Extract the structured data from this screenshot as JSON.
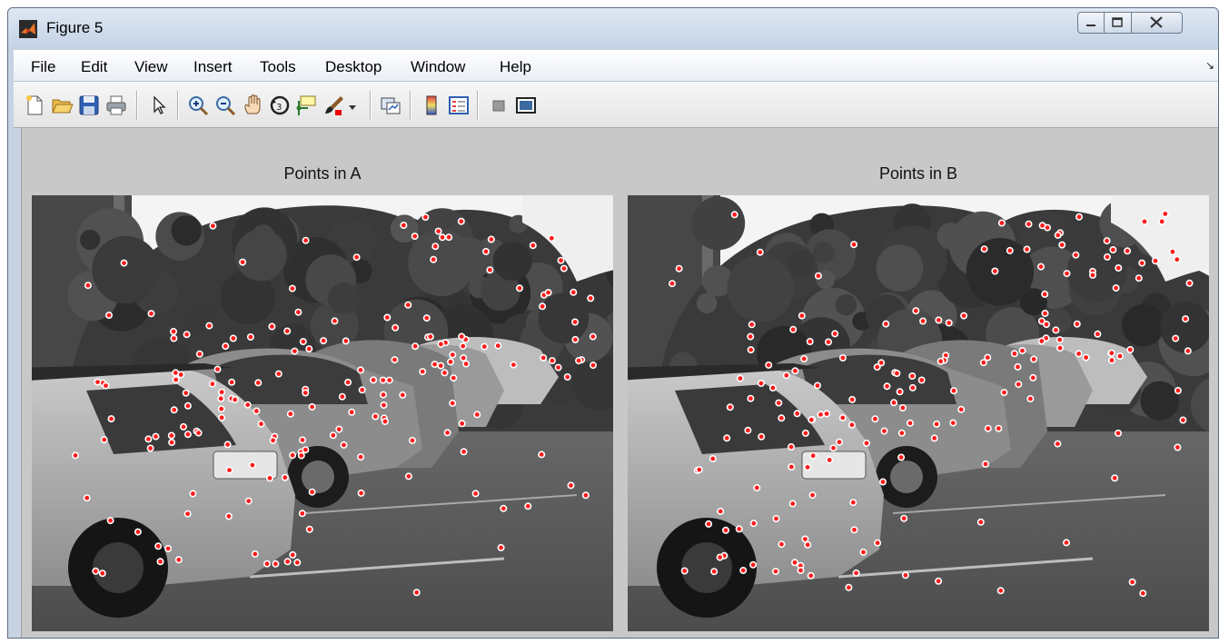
{
  "window": {
    "title": "Figure 5"
  },
  "menubar": {
    "items": [
      "File",
      "Edit",
      "View",
      "Insert",
      "Tools",
      "Desktop",
      "Window",
      "Help"
    ]
  },
  "toolbar": {
    "icons": [
      "new-figure-icon",
      "open-file-icon",
      "save-icon",
      "print-icon",
      "pointer-icon",
      "zoom-in-icon",
      "zoom-out-icon",
      "pan-icon",
      "rotate-3d-icon",
      "data-cursor-icon",
      "brush-icon",
      "link-plot-icon",
      "colorbar-icon",
      "legend-icon",
      "hide-plot-tools-icon",
      "show-plot-tools-icon"
    ]
  },
  "axes": [
    {
      "title": "Points in A"
    },
    {
      "title": "Points in B"
    }
  ],
  "colors": {
    "marker_fill": "#ff1a1a",
    "marker_edge": "#ffffff",
    "figure_bg": "#c8c8c8"
  }
}
